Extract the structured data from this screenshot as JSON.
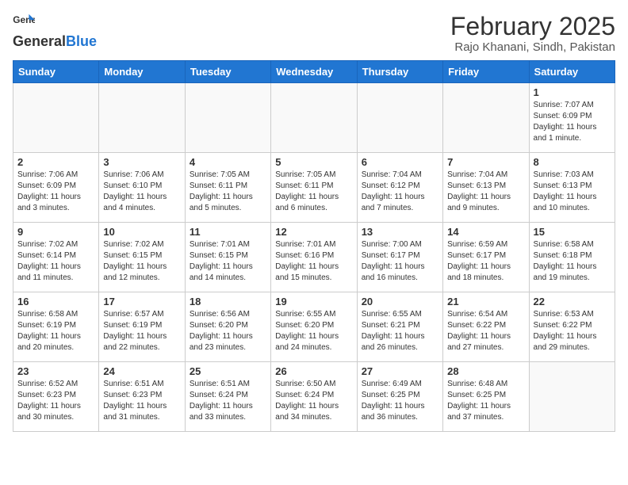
{
  "header": {
    "logo_general": "General",
    "logo_blue": "Blue",
    "month_title": "February 2025",
    "location": "Rajo Khanani, Sindh, Pakistan"
  },
  "weekdays": [
    "Sunday",
    "Monday",
    "Tuesday",
    "Wednesday",
    "Thursday",
    "Friday",
    "Saturday"
  ],
  "weeks": [
    [
      {
        "day": "",
        "info": ""
      },
      {
        "day": "",
        "info": ""
      },
      {
        "day": "",
        "info": ""
      },
      {
        "day": "",
        "info": ""
      },
      {
        "day": "",
        "info": ""
      },
      {
        "day": "",
        "info": ""
      },
      {
        "day": "1",
        "info": "Sunrise: 7:07 AM\nSunset: 6:09 PM\nDaylight: 11 hours\nand 1 minute."
      }
    ],
    [
      {
        "day": "2",
        "info": "Sunrise: 7:06 AM\nSunset: 6:09 PM\nDaylight: 11 hours\nand 3 minutes."
      },
      {
        "day": "3",
        "info": "Sunrise: 7:06 AM\nSunset: 6:10 PM\nDaylight: 11 hours\nand 4 minutes."
      },
      {
        "day": "4",
        "info": "Sunrise: 7:05 AM\nSunset: 6:11 PM\nDaylight: 11 hours\nand 5 minutes."
      },
      {
        "day": "5",
        "info": "Sunrise: 7:05 AM\nSunset: 6:11 PM\nDaylight: 11 hours\nand 6 minutes."
      },
      {
        "day": "6",
        "info": "Sunrise: 7:04 AM\nSunset: 6:12 PM\nDaylight: 11 hours\nand 7 minutes."
      },
      {
        "day": "7",
        "info": "Sunrise: 7:04 AM\nSunset: 6:13 PM\nDaylight: 11 hours\nand 9 minutes."
      },
      {
        "day": "8",
        "info": "Sunrise: 7:03 AM\nSunset: 6:13 PM\nDaylight: 11 hours\nand 10 minutes."
      }
    ],
    [
      {
        "day": "9",
        "info": "Sunrise: 7:02 AM\nSunset: 6:14 PM\nDaylight: 11 hours\nand 11 minutes."
      },
      {
        "day": "10",
        "info": "Sunrise: 7:02 AM\nSunset: 6:15 PM\nDaylight: 11 hours\nand 12 minutes."
      },
      {
        "day": "11",
        "info": "Sunrise: 7:01 AM\nSunset: 6:15 PM\nDaylight: 11 hours\nand 14 minutes."
      },
      {
        "day": "12",
        "info": "Sunrise: 7:01 AM\nSunset: 6:16 PM\nDaylight: 11 hours\nand 15 minutes."
      },
      {
        "day": "13",
        "info": "Sunrise: 7:00 AM\nSunset: 6:17 PM\nDaylight: 11 hours\nand 16 minutes."
      },
      {
        "day": "14",
        "info": "Sunrise: 6:59 AM\nSunset: 6:17 PM\nDaylight: 11 hours\nand 18 minutes."
      },
      {
        "day": "15",
        "info": "Sunrise: 6:58 AM\nSunset: 6:18 PM\nDaylight: 11 hours\nand 19 minutes."
      }
    ],
    [
      {
        "day": "16",
        "info": "Sunrise: 6:58 AM\nSunset: 6:19 PM\nDaylight: 11 hours\nand 20 minutes."
      },
      {
        "day": "17",
        "info": "Sunrise: 6:57 AM\nSunset: 6:19 PM\nDaylight: 11 hours\nand 22 minutes."
      },
      {
        "day": "18",
        "info": "Sunrise: 6:56 AM\nSunset: 6:20 PM\nDaylight: 11 hours\nand 23 minutes."
      },
      {
        "day": "19",
        "info": "Sunrise: 6:55 AM\nSunset: 6:20 PM\nDaylight: 11 hours\nand 24 minutes."
      },
      {
        "day": "20",
        "info": "Sunrise: 6:55 AM\nSunset: 6:21 PM\nDaylight: 11 hours\nand 26 minutes."
      },
      {
        "day": "21",
        "info": "Sunrise: 6:54 AM\nSunset: 6:22 PM\nDaylight: 11 hours\nand 27 minutes."
      },
      {
        "day": "22",
        "info": "Sunrise: 6:53 AM\nSunset: 6:22 PM\nDaylight: 11 hours\nand 29 minutes."
      }
    ],
    [
      {
        "day": "23",
        "info": "Sunrise: 6:52 AM\nSunset: 6:23 PM\nDaylight: 11 hours\nand 30 minutes."
      },
      {
        "day": "24",
        "info": "Sunrise: 6:51 AM\nSunset: 6:23 PM\nDaylight: 11 hours\nand 31 minutes."
      },
      {
        "day": "25",
        "info": "Sunrise: 6:51 AM\nSunset: 6:24 PM\nDaylight: 11 hours\nand 33 minutes."
      },
      {
        "day": "26",
        "info": "Sunrise: 6:50 AM\nSunset: 6:24 PM\nDaylight: 11 hours\nand 34 minutes."
      },
      {
        "day": "27",
        "info": "Sunrise: 6:49 AM\nSunset: 6:25 PM\nDaylight: 11 hours\nand 36 minutes."
      },
      {
        "day": "28",
        "info": "Sunrise: 6:48 AM\nSunset: 6:25 PM\nDaylight: 11 hours\nand 37 minutes."
      },
      {
        "day": "",
        "info": ""
      }
    ]
  ]
}
